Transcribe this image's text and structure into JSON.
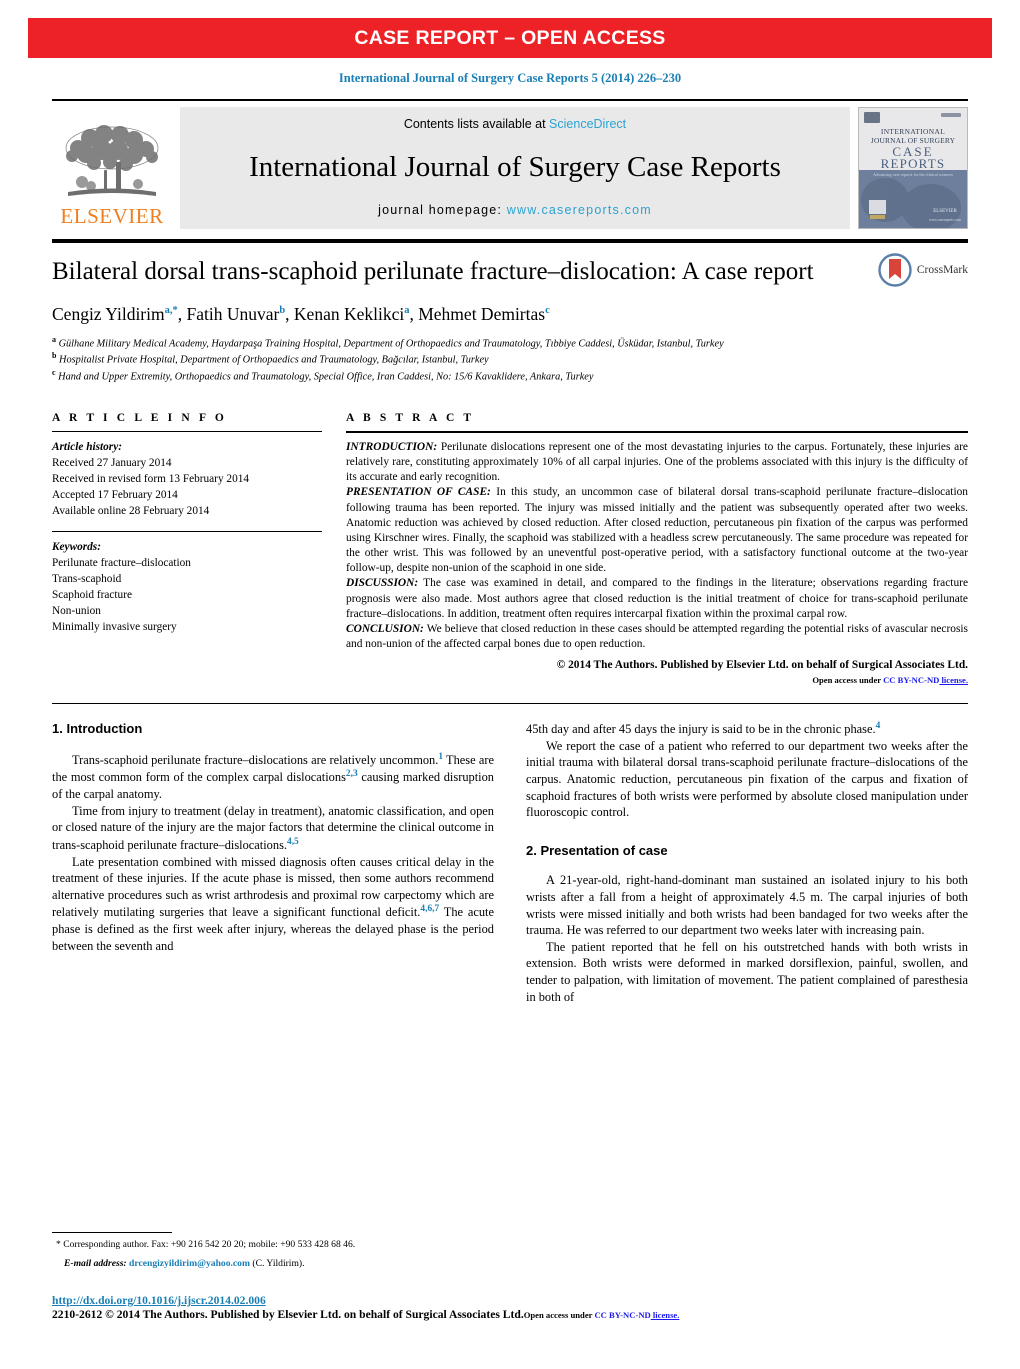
{
  "banner": {
    "text": "CASE REPORT – OPEN ACCESS"
  },
  "running_head": "International Journal of Surgery Case Reports 5 (2014) 226–230",
  "masthead": {
    "contents_prefix": "Contents lists available at ",
    "sciencedirect": "ScienceDirect",
    "journal_title": "International Journal of Surgery Case Reports",
    "homepage_prefix": "journal homepage: ",
    "homepage_url": "www.casereports.com",
    "elsevier_wordmark": "ELSEVIER",
    "cover": {
      "publisher": "ELSEVIER",
      "line1": "INTERNATIONAL",
      "line2": "JOURNAL OF SURGERY",
      "line3": "CASE",
      "line4": "REPORTS",
      "tagline": "Advancing case reports for the clinical sciences",
      "site": "www.casereports.com"
    }
  },
  "article": {
    "title": "Bilateral dorsal trans-scaphoid perilunate fracture–dislocation: A case report",
    "crossmark_label": "CrossMark",
    "authors": [
      {
        "name": "Cengiz Yildirim",
        "marks": "a,*"
      },
      {
        "name": "Fatih Unuvar",
        "marks": "b"
      },
      {
        "name": "Kenan Keklikci",
        "marks": "a"
      },
      {
        "name": "Mehmet Demirtas",
        "marks": "c"
      }
    ],
    "affiliations": [
      {
        "mark": "a",
        "text": "Gülhane Military Medical Academy, Haydarpaşa Training Hospital, Department of Orthopaedics and Traumatology, Tıbbiye Caddesi, Üsküdar, Istanbul, Turkey"
      },
      {
        "mark": "b",
        "text": "Hospitalist Private Hospital, Department of Orthopaedics and Traumatology, Bağcılar, Istanbul, Turkey"
      },
      {
        "mark": "c",
        "text": "Hand and Upper Extremity, Orthopaedics and Traumatology, Special Office, Iran Caddesi, No: 15/6 Kavaklidere, Ankara, Turkey"
      }
    ]
  },
  "article_info": {
    "heading": "A R T I C L E   I N F O",
    "history_label": "Article history:",
    "history": [
      "Received 27 January 2014",
      "Received in revised form 13 February 2014",
      "Accepted 17 February 2014",
      "Available online 28 February 2014"
    ],
    "keywords_label": "Keywords:",
    "keywords": [
      "Perilunate fracture–dislocation",
      "Trans-scaphoid",
      "Scaphoid fracture",
      "Non-union",
      "Minimally invasive surgery"
    ]
  },
  "abstract": {
    "heading": "A B S T R A C T",
    "sections": [
      {
        "lead": "INTRODUCTION:",
        "text": " Perilunate dislocations represent one of the most devastating injuries to the carpus. Fortunately, these injuries are relatively rare, constituting approximately 10% of all carpal injuries. One of the problems associated with this injury is the difficulty of its accurate and early recognition."
      },
      {
        "lead": "PRESENTATION OF CASE:",
        "text": " In this study, an uncommon case of bilateral dorsal trans-scaphoid perilunate fracture–dislocation following trauma has been reported. The injury was missed initially and the patient was subsequently operated after two weeks. Anatomic reduction was achieved by closed reduction. After closed reduction, percutaneous pin fixation of the carpus was performed using Kirschner wires. Finally, the scaphoid was stabilized with a headless screw percutaneously. The same procedure was repeated for the other wrist. This was followed by an uneventful post-operative period, with a satisfactory functional outcome at the two-year follow-up, despite non-union of the scaphoid in one side."
      },
      {
        "lead": "DISCUSSION:",
        "text": " The case was examined in detail, and compared to the findings in the literature; observations regarding fracture prognosis were also made. Most authors agree that closed reduction is the initial treatment of choice for trans-scaphoid perilunate fracture–dislocations. In addition, treatment often requires intercarpal fixation within the proximal carpal row."
      },
      {
        "lead": "CONCLUSION:",
        "text": " We believe that closed reduction in these cases should be attempted regarding the potential risks of avascular necrosis and non-union of the affected carpal bones due to open reduction."
      }
    ],
    "copyright": "© 2014 The Authors. Published by Elsevier Ltd. on behalf of Surgical Associates Ltd.",
    "open_access_prefix": "Open access under ",
    "license": "CC BY-NC-ND",
    "license_suffix": " license."
  },
  "body": {
    "left_column": {
      "heading": "1.  Introduction",
      "paragraphs": [
        {
          "parts": [
            {
              "t": "Trans-scaphoid perilunate fracture–dislocations are relatively uncommon."
            },
            {
              "r": "1"
            },
            {
              "t": " These are the most common form of the complex carpal dislocations"
            },
            {
              "r": "2,3"
            },
            {
              "t": " causing marked disruption of the carpal anatomy."
            }
          ]
        },
        {
          "parts": [
            {
              "t": "Time from injury to treatment (delay in treatment), anatomic classification, and open or closed nature of the injury are the major factors that determine the clinical outcome in trans-scaphoid perilunate fracture–dislocations."
            },
            {
              "r": "4,5"
            }
          ]
        },
        {
          "parts": [
            {
              "t": "Late presentation combined with missed diagnosis often causes critical delay in the treatment of these injuries. If the acute phase is missed, then some authors recommend alternative procedures such as wrist arthrodesis and proximal row carpectomy which are relatively mutilating surgeries that leave a significant functional deficit."
            },
            {
              "r": "4,6,7"
            },
            {
              "t": " The acute phase is defined as the first week after injury, whereas the delayed phase is the period between the seventh and"
            }
          ]
        }
      ]
    },
    "right_column": {
      "continuation": {
        "parts": [
          {
            "t": "45th day and after 45 days the injury is said to be in the chronic phase."
          },
          {
            "r": "4"
          }
        ]
      },
      "paragraph_after": "We report the case of a patient who referred to our department two weeks after the initial trauma with bilateral dorsal trans-scaphoid perilunate fracture–dislocations of the carpus. Anatomic reduction, percutaneous pin fixation of the carpus and fixation of scaphoid fractures of both wrists were performed by absolute closed manipulation under fluoroscopic control.",
      "heading": "2.  Presentation of case",
      "paragraphs": [
        "A 21-year-old, right-hand-dominant man sustained an isolated injury to his both wrists after a fall from a height of approximately 4.5 m. The carpal injuries of both wrists were missed initially and both wrists had been bandaged for two weeks after the trauma. He was referred to our department two weeks later with increasing pain.",
        "The patient reported that he fell on his outstretched hands with both wrists in extension. Both wrists were deformed in marked dorsiflexion, painful, swollen, and tender to palpation, with limitation of movement. The patient complained of paresthesia in both of"
      ]
    }
  },
  "footnote": {
    "corresponding": "* Corresponding author. Fax: +90 216 542 20 20; mobile: +90 533 428 68 46.",
    "email_label": "E-mail address:",
    "email": "drcengizyildirim@yahoo.com",
    "email_suffix": " (C. Yildirim)."
  },
  "bottom": {
    "doi": "http://dx.doi.org/10.1016/j.ijscr.2014.02.006",
    "issn_line": "2210-2612 © 2014 The Authors. Published by Elsevier Ltd. on behalf of Surgical Associates Ltd.",
    "open_access_prefix": "Open access under ",
    "license": "CC BY-NC-ND",
    "license_suffix": " license."
  },
  "colors": {
    "banner_red": "#ec2227",
    "link_blue": "#1a7fb5",
    "sciencedirect_blue": "#2ba3d4",
    "elsevier_orange": "#ef7e20",
    "license_blue": "#1a1af0",
    "masthead_gray": "#e9e9e9"
  }
}
